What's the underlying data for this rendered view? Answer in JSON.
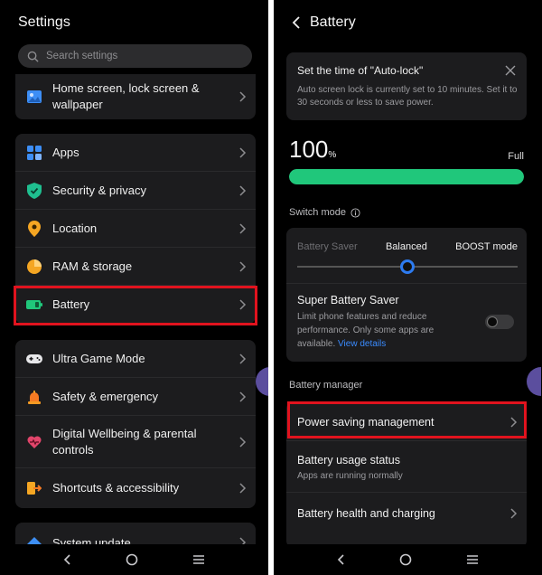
{
  "left": {
    "title": "Settings",
    "search_placeholder": "Search settings",
    "groups": [
      {
        "items": [
          {
            "label": "Home screen, lock screen & wallpaper",
            "icon": "image-icon"
          }
        ]
      },
      {
        "items": [
          {
            "label": "Apps",
            "icon": "apps-grid-icon"
          },
          {
            "label": "Security & privacy",
            "icon": "shield-check-icon"
          },
          {
            "label": "Location",
            "icon": "location-pin-icon"
          },
          {
            "label": "RAM & storage",
            "icon": "pie-chart-icon"
          },
          {
            "label": "Battery",
            "icon": "battery-icon"
          }
        ]
      },
      {
        "items": [
          {
            "label": "Ultra Game Mode",
            "icon": "gamepad-icon"
          },
          {
            "label": "Safety & emergency",
            "icon": "alarm-light-icon"
          },
          {
            "label": "Digital Wellbeing & parental controls",
            "icon": "heart-icon"
          },
          {
            "label": "Shortcuts & accessibility",
            "icon": "shortcut-icon"
          }
        ]
      },
      {
        "items": [
          {
            "label": "System update",
            "icon": "update-arrow-icon"
          }
        ]
      }
    ]
  },
  "right": {
    "title": "Battery",
    "notice": {
      "title": "Set the time of \"Auto-lock\"",
      "body": "Auto screen lock is currently set to 10 minutes. Set it to 30 seconds or less to save power."
    },
    "battery": {
      "percent": "100",
      "unit": "%",
      "status": "Full",
      "level": 1.0
    },
    "switch_mode_label": "Switch mode",
    "modes": [
      "Battery Saver",
      "Balanced",
      "BOOST mode"
    ],
    "selected_mode_fraction": 0.5,
    "super_saver": {
      "title": "Super Battery Saver",
      "desc": "Limit phone features and reduce performance. Only some apps are available.",
      "link": "View details",
      "enabled": false
    },
    "manager_label": "Battery manager",
    "manager_items": [
      {
        "title": "Power saving management",
        "sub": ""
      },
      {
        "title": "Battery usage status",
        "sub": "Apps are running normally"
      },
      {
        "title": "Battery health and charging",
        "sub": ""
      }
    ]
  },
  "colors": {
    "accent_green": "#20c77b",
    "accent_blue": "#2d7bf0",
    "highlight_red": "#e1131e",
    "card": "#1c1c1e"
  }
}
